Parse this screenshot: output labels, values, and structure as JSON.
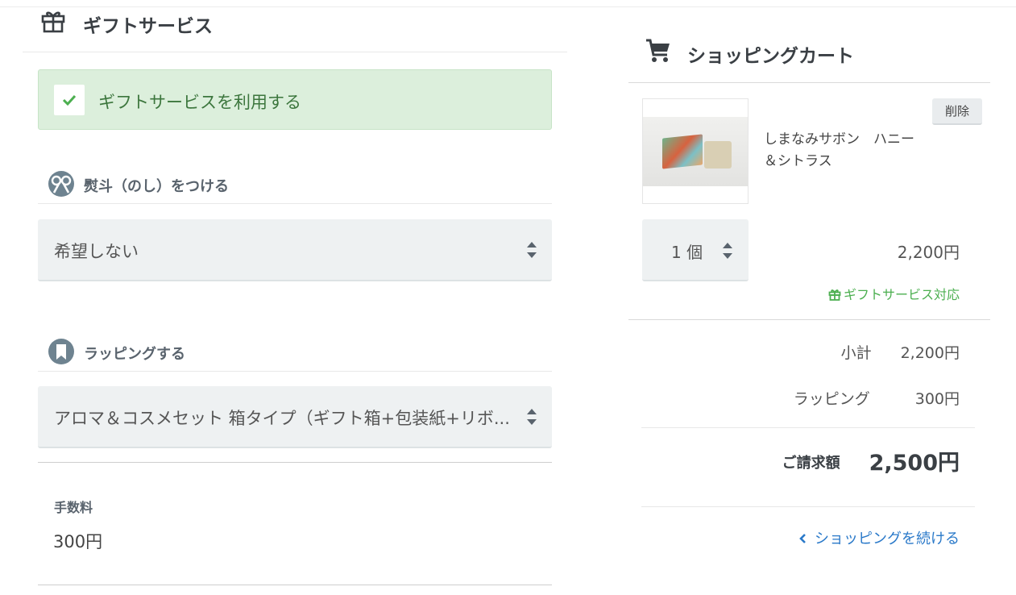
{
  "gift_service": {
    "title": "ギフトサービス",
    "use_label": "ギフトサービスを利用する",
    "use_checked": true
  },
  "noshi": {
    "title": "熨斗（のし）をつける",
    "selected": "希望しない"
  },
  "wrapping": {
    "title": "ラッピングする",
    "selected": "アロマ＆コスメセット 箱タイプ（ギフト箱+包装紙+リボ..."
  },
  "fee": {
    "label": "手数料",
    "value": "300円"
  },
  "cart": {
    "title": "ショッピングカート",
    "item": {
      "name": "しまなみサボン　ハニー＆シトラス",
      "delete_label": "削除",
      "quantity": "1 個",
      "price": "2,200円",
      "gift_badge": "ギフトサービス対応"
    },
    "subtotal_label": "小計",
    "subtotal_value": "2,200円",
    "wrapping_label": "ラッピング",
    "wrapping_value": "300円",
    "total_label": "ご請求額",
    "total_value": "2,500円",
    "continue_label": "ショッピングを続ける"
  },
  "colors": {
    "accent_green": "#4caf50",
    "link_blue": "#2a79c9",
    "checked_bg": "#dcefdc",
    "icon_gray": "#6e8390"
  }
}
